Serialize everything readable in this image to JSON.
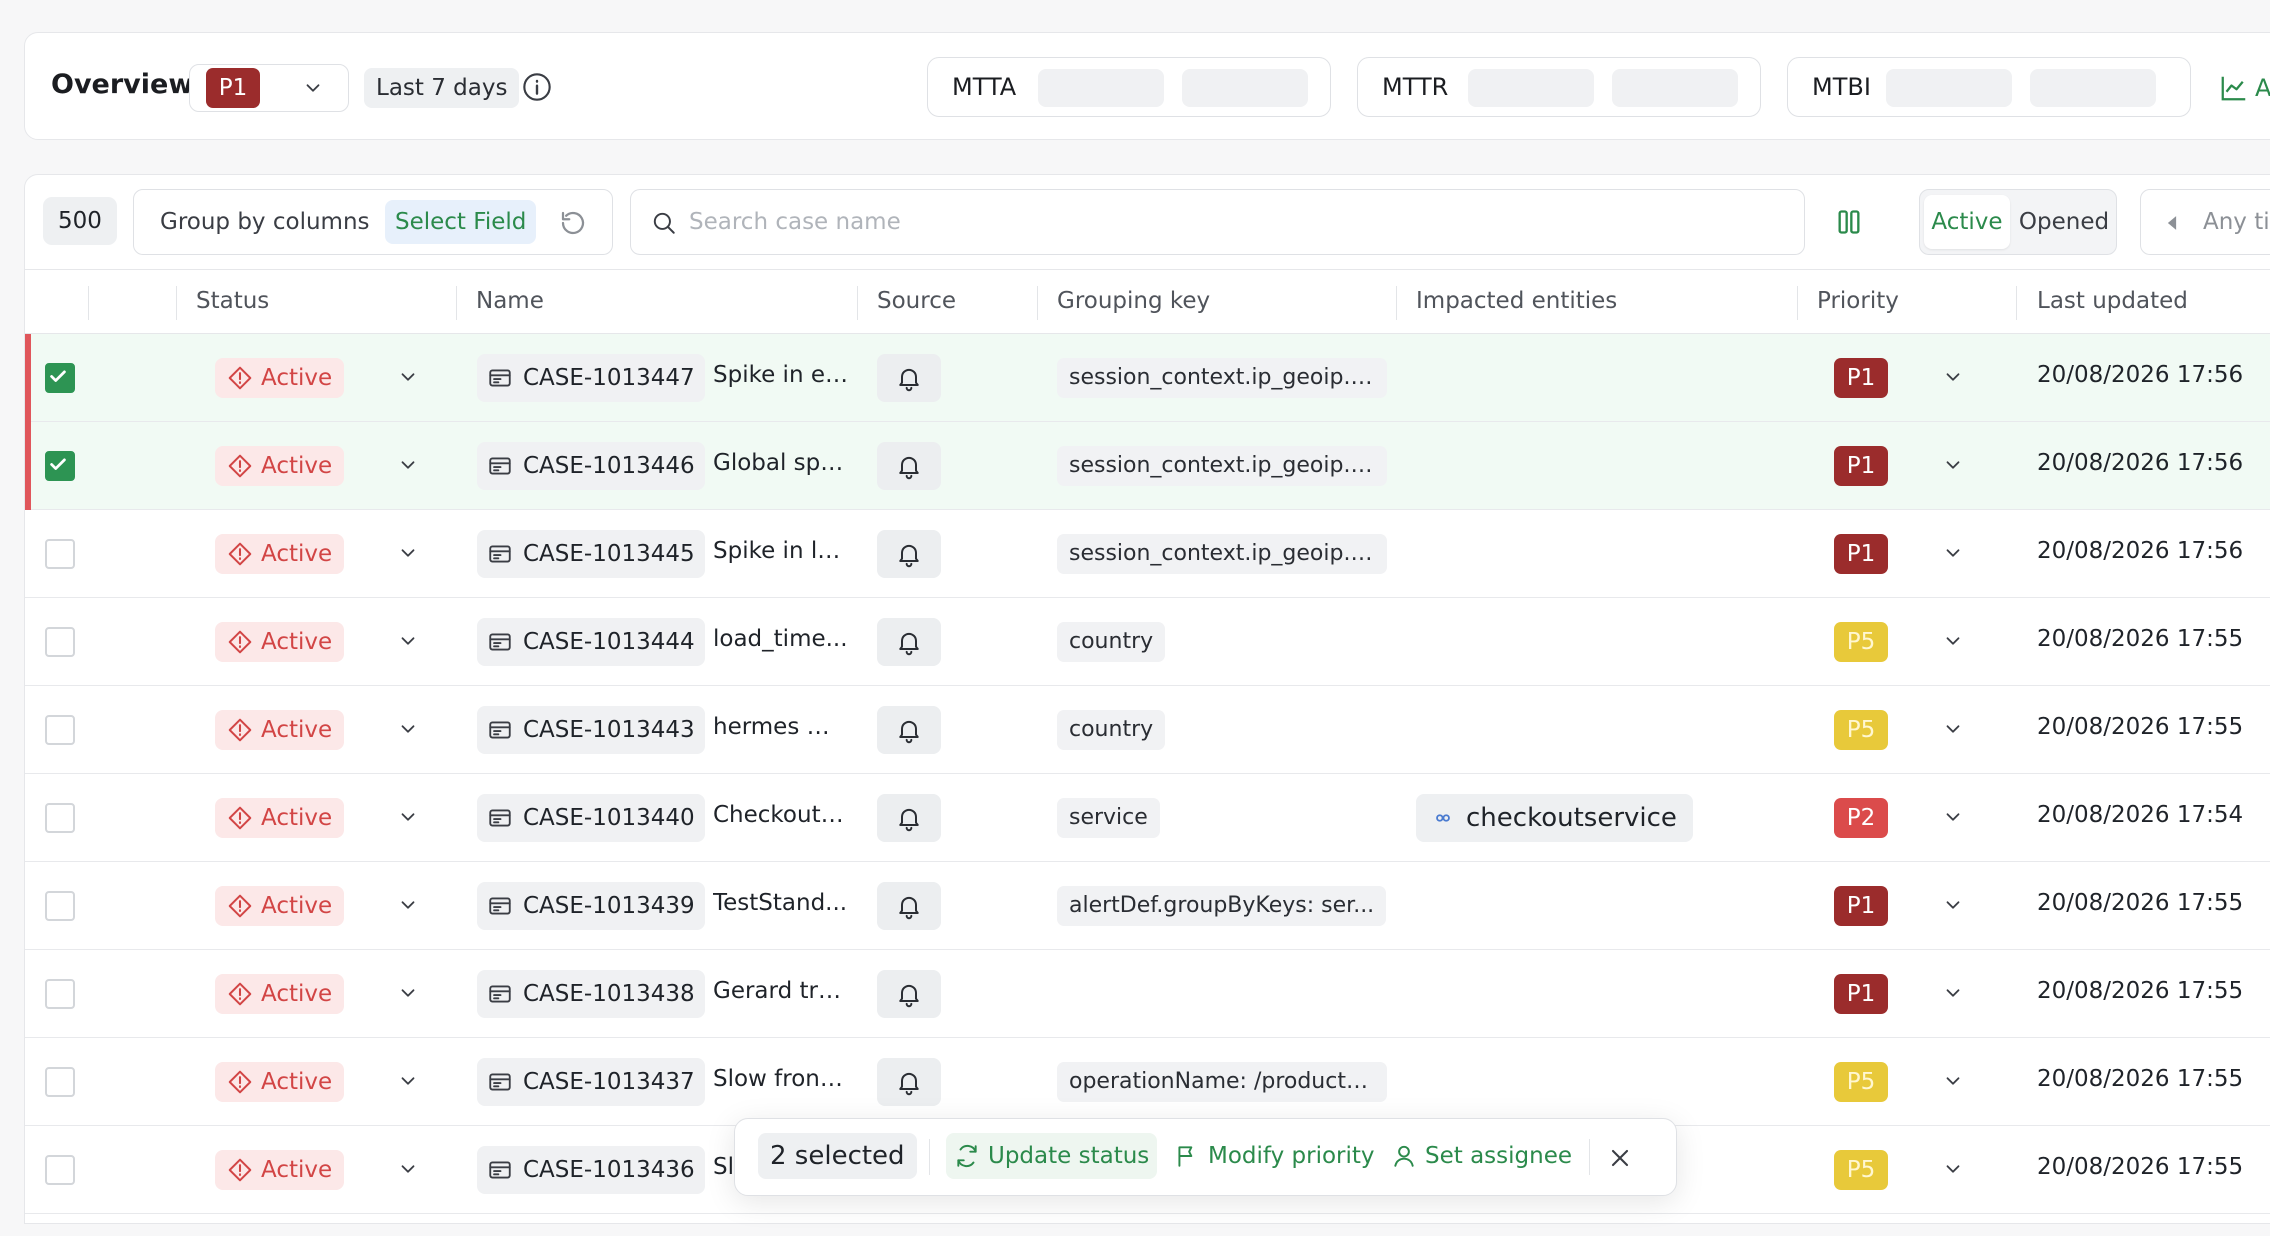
{
  "overview": {
    "title": "Overview",
    "priority_selected": "P1",
    "time_range": "Last 7 days",
    "metrics": [
      "MTTA",
      "MTTR",
      "MTBI"
    ],
    "chart_link_label": "A"
  },
  "toolbar": {
    "count": "500",
    "group_by_label": "Group by columns",
    "select_field_label": "Select Field",
    "search_placeholder": "Search case name",
    "seg_active": "Active",
    "seg_opened": "Opened",
    "time_placeholder": "Any ti"
  },
  "columns": {
    "status": "Status",
    "name": "Name",
    "source": "Source",
    "grouping_key": "Grouping key",
    "impacted_entities": "Impacted entities",
    "priority": "Priority",
    "last_updated": "Last updated"
  },
  "rows": [
    {
      "selected": true,
      "status": "Active",
      "case_id": "CASE-1013447",
      "name": "Spike in er...",
      "grouping_key": "session_context.ip_geoip.c...",
      "entity": "",
      "priority": "P1",
      "updated": "20/08/2026 17:56"
    },
    {
      "selected": true,
      "status": "Active",
      "case_id": "CASE-1013446",
      "name": "Global spi...",
      "grouping_key": "session_context.ip_geoip.c...",
      "entity": "",
      "priority": "P1",
      "updated": "20/08/2026 17:56"
    },
    {
      "selected": false,
      "status": "Active",
      "case_id": "CASE-1013445",
      "name": "Spike in la...",
      "grouping_key": "session_context.ip_geoip.c...",
      "entity": "",
      "priority": "P1",
      "updated": "20/08/2026 17:56"
    },
    {
      "selected": false,
      "status": "Active",
      "case_id": "CASE-1013444",
      "name": "load_time...",
      "grouping_key": "country",
      "entity": "",
      "priority": "P5",
      "updated": "20/08/2026 17:55"
    },
    {
      "selected": false,
      "status": "Active",
      "case_id": "CASE-1013443",
      "name": "hermes m...",
      "grouping_key": "country",
      "entity": "",
      "priority": "P5",
      "updated": "20/08/2026 17:55"
    },
    {
      "selected": false,
      "status": "Active",
      "case_id": "CASE-1013440",
      "name": "Checkout ...",
      "grouping_key": "service",
      "entity": "checkoutservice",
      "priority": "P2",
      "updated": "20/08/2026 17:54"
    },
    {
      "selected": false,
      "status": "Active",
      "case_id": "CASE-1013439",
      "name": "TestStand...",
      "grouping_key": "alertDef.groupByKeys: ser...",
      "entity": "",
      "priority": "P1",
      "updated": "20/08/2026 17:55"
    },
    {
      "selected": false,
      "status": "Active",
      "case_id": "CASE-1013438",
      "name": "Gerard tra...",
      "grouping_key": "",
      "entity": "",
      "priority": "P1",
      "updated": "20/08/2026 17:55"
    },
    {
      "selected": false,
      "status": "Active",
      "case_id": "CASE-1013437",
      "name": "Slow front...",
      "grouping_key": "operationName: /product/{...",
      "entity": "",
      "priority": "P5",
      "updated": "20/08/2026 17:55"
    },
    {
      "selected": false,
      "status": "Active",
      "case_id": "CASE-1013436",
      "name": "Sl",
      "grouping_key": "",
      "entity": "",
      "priority": "P5",
      "updated": "20/08/2026 17:55"
    }
  ],
  "action_bar": {
    "selected_text": "2 selected",
    "update_status": "Update status",
    "modify_priority": "Modify priority",
    "set_assignee": "Set assignee"
  },
  "colors": {
    "accent_green": "#2b8a4b",
    "checkbox_green": "#2d9453",
    "active_red": "#d24545",
    "p1": "#9b2c2c",
    "p2": "#db4b4b",
    "p5": "#e8c93a",
    "selected_row_bg": "#f1faf4",
    "selected_bar": "#e0565b"
  },
  "icons": [
    "chevron-down-icon",
    "info-icon",
    "line-chart-icon",
    "reset-icon",
    "search-icon",
    "columns-icon",
    "caret-left-icon",
    "check-icon",
    "alert-diamond-icon",
    "case-card-icon",
    "bell-icon",
    "link-icon",
    "refresh-icon",
    "flag-icon",
    "user-icon",
    "close-icon"
  ]
}
